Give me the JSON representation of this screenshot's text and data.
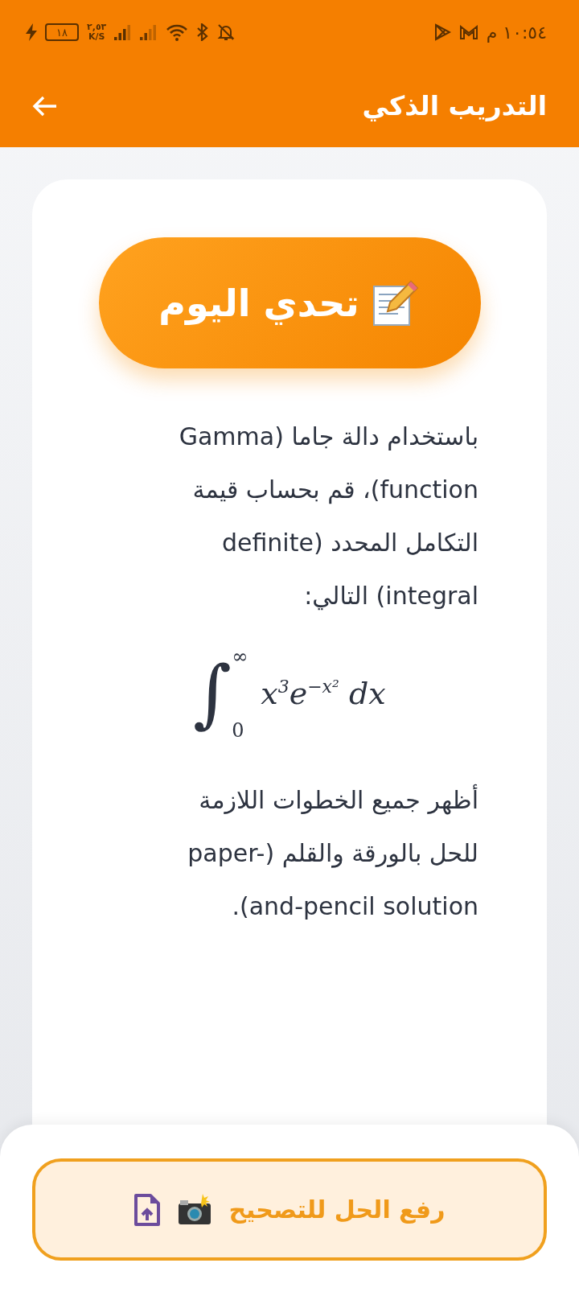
{
  "status_bar": {
    "battery": "١٨",
    "charging": true,
    "speed": "٢,٥٣",
    "speed_unit": "K/S",
    "time": "١٠:٥٤ م"
  },
  "header": {
    "title": "التدريب الذكي"
  },
  "challenge": {
    "title": "تحدي اليوم"
  },
  "question": {
    "intro": "باستخدام دالة جاما (Gamma function)، قم بحساب قيمة التكامل المحدد (definite integral) التالي:",
    "formula": {
      "sign": "∫",
      "upper": "∞",
      "lower": "0",
      "integrand": "x$^{3}$e$^{−x²}$ dx"
    },
    "instruction": "أظهر جميع الخطوات اللازمة للحل بالورقة والقلم (paper-and-pencil solution)."
  },
  "upload_button": {
    "label": "رفع الحل للتصحيح"
  }
}
